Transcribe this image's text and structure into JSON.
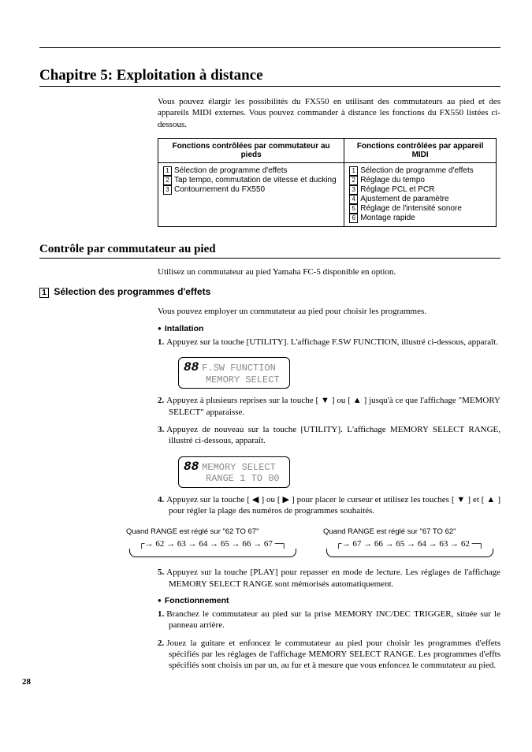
{
  "chapter_title": "Chapitre 5: Exploitation à distance",
  "intro": "Vous pouvez élargir les possibilités du FX550 en utilisant des commutateurs au pied et des appareils MIDI externes. Vous pouvez commander à distance les fonctions du FX550 listées ci-dessous.",
  "table": {
    "header_left": "Fonctions contrôlées par commutateur au pieds",
    "header_right": "Fonctions contrôlées par appareil MIDI",
    "left_items": [
      "Sélection de programme d'effets",
      "Tap tempo, commutation de vitesse et ducking",
      "Contournement du FX550"
    ],
    "right_items": [
      "Sélection de programme d'effets",
      "Réglage du tempo",
      "Réglage PCL et PCR",
      "Ajustement de paramètre",
      "Réglage de l'intensité sonore",
      "Montage rapide"
    ]
  },
  "section1_title": "Contrôle par commutateur au pied",
  "section1_intro": "Utilisez un commutateur au pied Yamaha FC-5 disponible en option.",
  "sub1_num": "1",
  "sub1_title": "Sélection des programmes d'effets",
  "sub1_intro": "Vous pouvez employer un commutateur au pied pour choisir les programmes.",
  "installation_hdr": "Intallation",
  "steps_install": [
    "Appuyez sur la touche [UTILITY]. L'affichage F.SW FUNCTION, illustré ci-dessous, apparaît.",
    "Appuyez à plusieurs reprises sur la touche [ ▼ ] ou [ ▲ ] jusqu'à ce que l'affichage \"MEMORY SELECT\" apparaisse.",
    "Appuyez de nouveau sur la touche [UTILITY]. L'affichage MEMORY SELECT RANGE, illustré ci-dessous, apparaît.",
    "Appuyez sur la touche [ ◀ ] ou [ ▶ ] pour placer le curseur et utilisez les touches [ ▼ ] et [ ▲ ] pour régler la plage des numéros de programmes souhaités.",
    "Appuyez sur la touche [PLAY] pour repasser en mode de lecture. Les réglages de l'affichage MEMORY SELECT RANGE sont mémorisés automatiquement."
  ],
  "lcd1_big": "88",
  "lcd1_line1": "F.SW FUNCTION",
  "lcd1_line2": "MEMORY SELECT",
  "lcd2_big": "88",
  "lcd2_line1": "MEMORY SELECT",
  "lcd2_line2": "RANGE  1 TO 00",
  "range_left_label": "Quand RANGE est réglé sur \"62 TO 67\"",
  "range_right_label": "Quand RANGE est réglé sur \"67 TO 62\"",
  "range_left_seq": "62 → 63 → 64 → 65 → 66 → 67",
  "range_right_seq": "67 → 66 → 65 → 64 → 63 → 62",
  "func_hdr": "Fonctionnement",
  "steps_func": [
    "Branchez le commutateur au pied sur la prise MEMORY INC/DEC TRIGGER, située sur le panneau arrière.",
    "Jouez la guitare et enfoncez le commutateur au pied pour choisir les programmes d'effets spécifiés par les réglages de l'affichage MEMORY SELECT RANGE. Les programmes d'effts spécifiés sont choisis un par un, au fur et à mesure que vous enfoncez le commutateur au pied."
  ],
  "page_number": "28"
}
